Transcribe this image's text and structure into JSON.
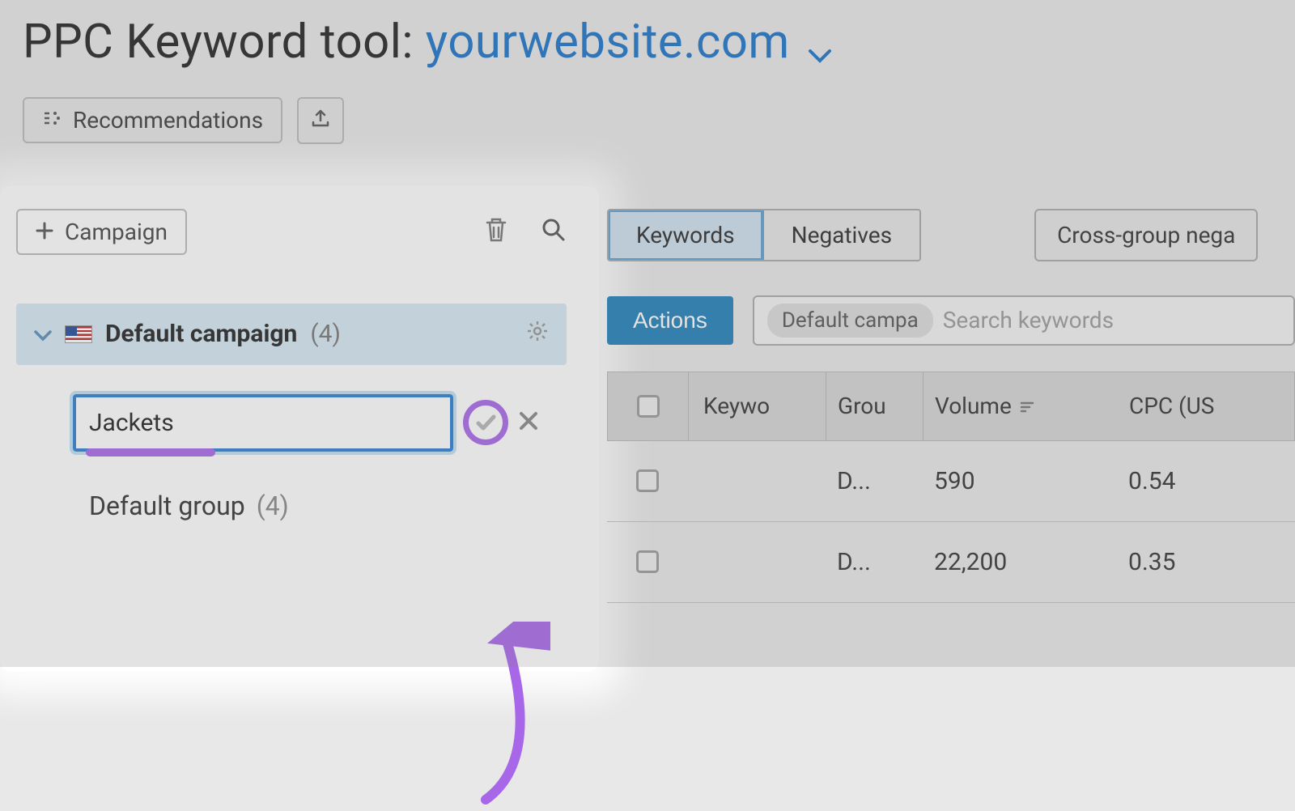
{
  "header": {
    "title_prefix": "PPC Keyword tool:",
    "domain": "yourwebsite.com"
  },
  "toolbar": {
    "recommendations_label": "Recommendations"
  },
  "sidebar": {
    "add_campaign_label": "Campaign",
    "campaign": {
      "name": "Default campaign",
      "count_display": "(4)"
    },
    "group_input_value": "Jackets",
    "default_group": {
      "name": "Default group",
      "count_display": "(4)"
    }
  },
  "content": {
    "tabs": {
      "keywords": "Keywords",
      "negatives": "Negatives"
    },
    "cross_group_label": "Cross-group nega",
    "actions_label": "Actions",
    "filter_chip": "Default campa",
    "search_placeholder": "Search keywords",
    "columns": {
      "keyword": "Keywo",
      "group": "Grou",
      "volume": "Volume",
      "cpc": "CPC (US"
    },
    "rows": [
      {
        "group": "D...",
        "volume": "590",
        "cpc": "0.54"
      },
      {
        "group": "D...",
        "volume": "22,200",
        "cpc": "0.35"
      }
    ]
  }
}
